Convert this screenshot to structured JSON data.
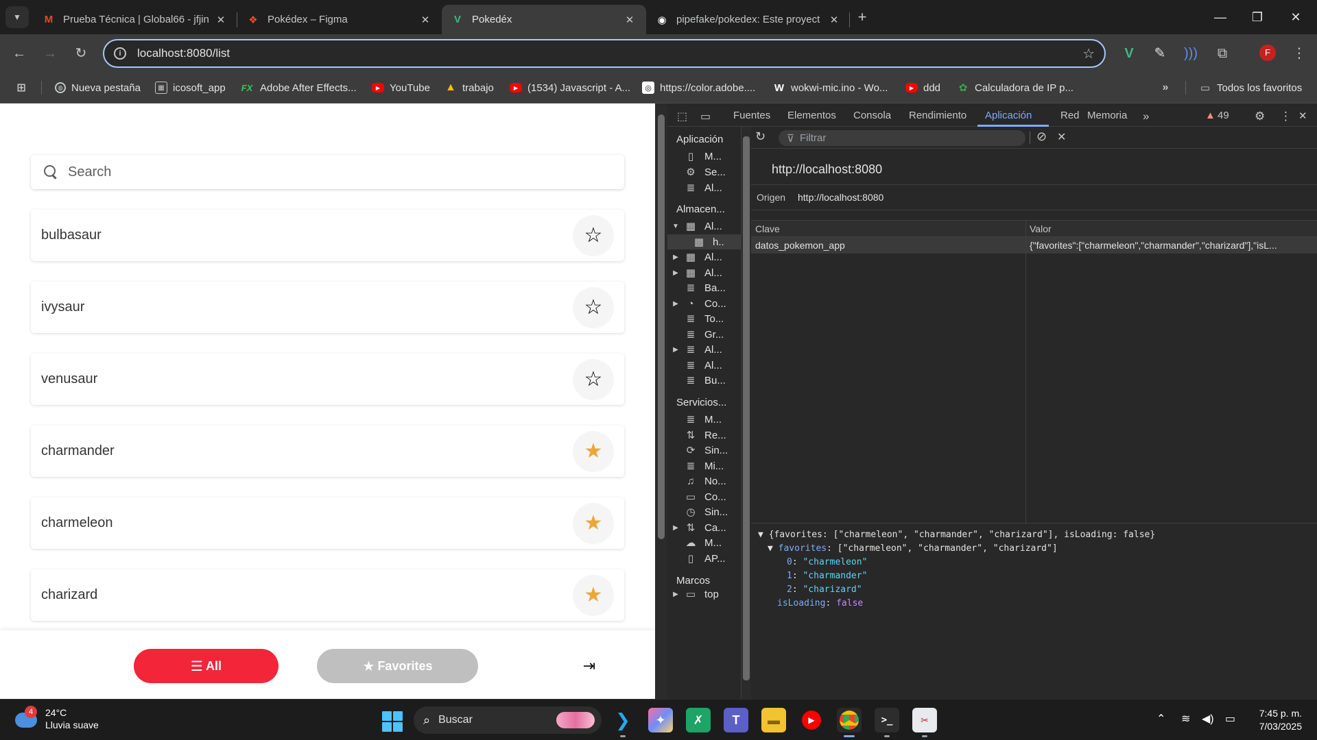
{
  "browser": {
    "tabs": [
      {
        "title": "Prueba Técnica | Global66 - jfjin",
        "icon": "gmail-icon",
        "color": "#ea4335",
        "active": false
      },
      {
        "title": "Pokédex – Figma",
        "icon": "figma-icon",
        "color": "#f24e1e",
        "active": false
      },
      {
        "title": "Pokedéx",
        "icon": "vue-icon",
        "color": "#41b883",
        "active": true
      },
      {
        "title": "pipefake/pokedex: Este proyect",
        "icon": "github-icon",
        "color": "#ffffff",
        "active": false
      }
    ],
    "address": "localhost:8080/list",
    "profile_initial": "F",
    "bookmarks": [
      "Nueva pestaña",
      "icosoft_app",
      "Adobe After Effects...",
      "YouTube",
      "trabajo",
      "(1534) Javascript - A...",
      "https://color.adobe....",
      "wokwi-mic.ino - Wo...",
      "ddd",
      "Calculadora de IP p..."
    ],
    "all_bookmarks": "Todos los favoritos"
  },
  "app": {
    "search_placeholder": "Search",
    "pokemon": [
      {
        "name": "bulbasaur",
        "favorite": false
      },
      {
        "name": "ivysaur",
        "favorite": false
      },
      {
        "name": "venusaur",
        "favorite": false
      },
      {
        "name": "charmander",
        "favorite": true
      },
      {
        "name": "charmeleon",
        "favorite": true
      },
      {
        "name": "charizard",
        "favorite": true
      }
    ],
    "footer": {
      "all_label": "All",
      "favorites_label": "Favorites",
      "colors": {
        "all": "#f22539",
        "favorites": "#bfbfbf",
        "star": "#eca539"
      }
    }
  },
  "devtools": {
    "tabs": [
      "Fuentes",
      "Elementos",
      "Consola",
      "Rendimiento",
      "Aplicación",
      "Red",
      "Memoria"
    ],
    "active_tab": "Aplicación",
    "warnings": "49",
    "sidebar": {
      "app_header": "Aplicación",
      "app_items": [
        "M...",
        "Se...",
        "Al..."
      ],
      "storage_header": "Almacen...",
      "storage_items": [
        "Al...",
        "h..",
        "Al...",
        "Al...",
        "Ba...",
        "Co...",
        "To...",
        "Gr...",
        "Al...",
        "Al...",
        "Bu..."
      ],
      "services_header": "Servicios...",
      "services_items": [
        "M...",
        "Re...",
        "Sin...",
        "Mi...",
        "No...",
        "Co...",
        "Sin...",
        "Ca...",
        "M...",
        "AP..."
      ],
      "frames_header": "Marcos",
      "frames_items": [
        "top"
      ]
    },
    "filter_placeholder": "Filtrar",
    "origin_url": "http://localhost:8080",
    "origin_label": "Origen",
    "origin_value": "http://localhost:8080",
    "table": {
      "headers": [
        "Clave",
        "Valor"
      ],
      "rows": [
        {
          "key": "datos_pokemon_app",
          "value": "{\"favorites\":[\"charmeleon\",\"charmander\",\"charizard\"],\"isL..."
        }
      ]
    },
    "preview": {
      "line1": "{favorites: [\"charmeleon\", \"charmander\", \"charizard\"], isLoading: false}",
      "fav_key": "favorites",
      "fav_val": "[\"charmeleon\", \"charmander\", \"charizard\"]",
      "items": [
        "\"charmeleon\"",
        "\"charmander\"",
        "\"charizard\""
      ],
      "loading_key": "isLoading",
      "loading_val": "false"
    }
  },
  "taskbar": {
    "weather_temp": "24°C",
    "weather_desc": "Lluvia suave",
    "weather_badge": "4",
    "search": "Buscar",
    "time": "7:45 p. m.",
    "date": "7/03/2025"
  }
}
